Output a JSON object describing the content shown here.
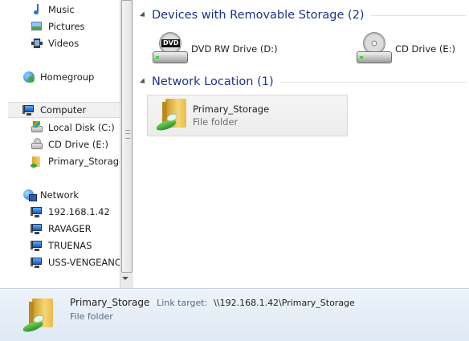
{
  "nav": {
    "items": [
      {
        "label": "Music",
        "icon": "music-icon"
      },
      {
        "label": "Pictures",
        "icon": "pictures-icon"
      },
      {
        "label": "Videos",
        "icon": "videos-icon"
      },
      {
        "label": "Homegroup",
        "icon": "homegroup-icon"
      },
      {
        "label": "Computer",
        "icon": "computer-icon"
      },
      {
        "label": "Local Disk (C:)",
        "icon": "local-disk-icon"
      },
      {
        "label": "CD Drive (E:)",
        "icon": "cd-drive-icon"
      },
      {
        "label": "Primary_Storage",
        "icon": "network-folder-icon"
      },
      {
        "label": "Network",
        "icon": "network-icon"
      },
      {
        "label": "192.168.1.42",
        "icon": "network-computer-icon"
      },
      {
        "label": "RAVAGER",
        "icon": "network-computer-icon"
      },
      {
        "label": "TRUENAS",
        "icon": "network-computer-icon"
      },
      {
        "label": "USS-VENGEANCE",
        "icon": "network-computer-icon"
      }
    ]
  },
  "main": {
    "groups": [
      {
        "title": "Devices with Removable Storage (2)",
        "items": [
          {
            "name": "DVD RW Drive (D:)",
            "icon": "dvd-drive-icon"
          },
          {
            "name": "CD Drive (E:)",
            "icon": "cd-drive-icon"
          }
        ]
      },
      {
        "title": "Network Location (1)",
        "items": [
          {
            "name": "Primary_Storage",
            "type": "File folder",
            "icon": "network-folder-icon"
          }
        ]
      }
    ]
  },
  "details": {
    "name": "Primary_Storage",
    "link_target_label": "Link target:",
    "link_target_value": "\\\\192.168.1.42\\Primary_Storage",
    "type": "File folder"
  },
  "colors": {
    "group_title": "#1e3287",
    "details_bg": "#e5edf7",
    "selected_bg": "#f0f0f0"
  }
}
